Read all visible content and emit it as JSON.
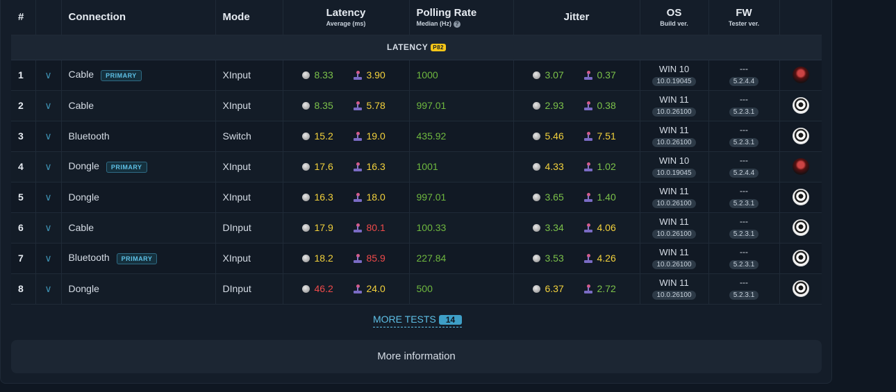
{
  "header": {
    "num": "#",
    "connection": "Connection",
    "mode": "Mode",
    "latency": "Latency",
    "latency_sub": "Average (ms)",
    "polling": "Polling Rate",
    "polling_sub": "Median (Hz)",
    "jitter": "Jitter",
    "os": "OS",
    "os_sub": "Build ver.",
    "fw": "FW",
    "fw_sub": "Tester ver."
  },
  "section": {
    "label": "LATENCY",
    "tag": "P82"
  },
  "primary_label": "PRIMARY",
  "rows": [
    {
      "n": "1",
      "conn": "Cable",
      "primary": true,
      "mode": "XInput",
      "lat_a": "8.33",
      "lat_b": "3.90",
      "poll": "1000",
      "jit_a": "3.07",
      "jit_b": "0.37",
      "os": "WIN 10",
      "os_build": "10.0.19045",
      "fw": "---",
      "fw_ver": "5.2.4.4",
      "avatar": "dark"
    },
    {
      "n": "2",
      "conn": "Cable",
      "primary": false,
      "mode": "XInput",
      "lat_a": "8.35",
      "lat_b": "5.78",
      "poll": "997.01",
      "jit_a": "2.93",
      "jit_b": "0.38",
      "os": "WIN 11",
      "os_build": "10.0.26100",
      "fw": "---",
      "fw_ver": "5.2.3.1",
      "avatar": "light"
    },
    {
      "n": "3",
      "conn": "Bluetooth",
      "primary": false,
      "mode": "Switch",
      "lat_a": "15.2",
      "lat_b": "19.0",
      "poll": "435.92",
      "jit_a": "5.46",
      "jit_b": "7.51",
      "os": "WIN 11",
      "os_build": "10.0.26100",
      "fw": "---",
      "fw_ver": "5.2.3.1",
      "avatar": "light"
    },
    {
      "n": "4",
      "conn": "Dongle",
      "primary": true,
      "mode": "XInput",
      "lat_a": "17.6",
      "lat_b": "16.3",
      "poll": "1001",
      "jit_a": "4.33",
      "jit_b": "1.02",
      "os": "WIN 10",
      "os_build": "10.0.19045",
      "fw": "---",
      "fw_ver": "5.2.4.4",
      "avatar": "dark"
    },
    {
      "n": "5",
      "conn": "Dongle",
      "primary": false,
      "mode": "XInput",
      "lat_a": "16.3",
      "lat_b": "18.0",
      "poll": "997.01",
      "jit_a": "3.65",
      "jit_b": "1.40",
      "os": "WIN 11",
      "os_build": "10.0.26100",
      "fw": "---",
      "fw_ver": "5.2.3.1",
      "avatar": "light"
    },
    {
      "n": "6",
      "conn": "Cable",
      "primary": false,
      "mode": "DInput",
      "lat_a": "17.9",
      "lat_b": "80.1",
      "poll": "100.33",
      "jit_a": "3.34",
      "jit_b": "4.06",
      "os": "WIN 11",
      "os_build": "10.0.26100",
      "fw": "---",
      "fw_ver": "5.2.3.1",
      "avatar": "light"
    },
    {
      "n": "7",
      "conn": "Bluetooth",
      "primary": true,
      "mode": "XInput",
      "lat_a": "18.2",
      "lat_b": "85.9",
      "poll": "227.84",
      "jit_a": "3.53",
      "jit_b": "4.26",
      "os": "WIN 11",
      "os_build": "10.0.26100",
      "fw": "---",
      "fw_ver": "5.2.3.1",
      "avatar": "light"
    },
    {
      "n": "8",
      "conn": "Dongle",
      "primary": false,
      "mode": "DInput",
      "lat_a": "46.2",
      "lat_b": "24.0",
      "poll": "500",
      "jit_a": "6.37",
      "jit_b": "2.72",
      "os": "WIN 11",
      "os_build": "10.0.26100",
      "fw": "---",
      "fw_ver": "5.2.3.1",
      "avatar": "light"
    }
  ],
  "colors": {
    "lat_a": [
      "g",
      "g",
      "y",
      "y",
      "y",
      "y",
      "y",
      "r"
    ],
    "lat_b": [
      "y",
      "y",
      "y",
      "y",
      "y",
      "r",
      "r",
      "y"
    ],
    "jit_a": [
      "g",
      "g",
      "y",
      "y",
      "g",
      "g",
      "g",
      "y"
    ],
    "jit_b": [
      "g",
      "g",
      "y",
      "g",
      "g",
      "y",
      "y",
      "g"
    ]
  },
  "more_tests": {
    "label": "MORE TESTS",
    "count": "14"
  },
  "more_info": "More information"
}
